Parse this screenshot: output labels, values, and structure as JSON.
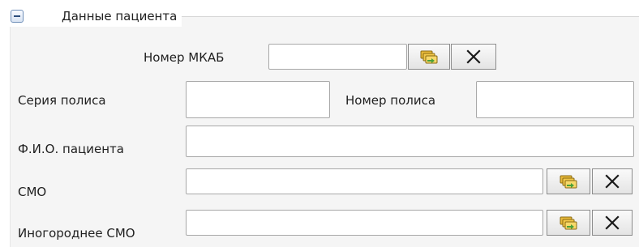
{
  "panel": {
    "title": "Данные пациента",
    "toggle_icon": "collapse-minus-icon"
  },
  "fields": {
    "mkab_number": {
      "label": "Номер МКАБ",
      "value": ""
    },
    "policy_series": {
      "label": "Серия полиса",
      "value": ""
    },
    "policy_number": {
      "label": "Номер полиса",
      "value": ""
    },
    "patient_name": {
      "label": "Ф.И.О. пациента",
      "value": ""
    },
    "smo": {
      "label": "СМО",
      "value": ""
    },
    "nonresident_smo": {
      "label": "Иногороднее СМО",
      "value": ""
    }
  },
  "icons": {
    "select": "folders-select-icon",
    "clear": "close-x-icon"
  },
  "colors": {
    "panel_background": "#f5f5f5",
    "toggle_border": "#6f8fb8",
    "folder_fill": "#f2c84b"
  }
}
